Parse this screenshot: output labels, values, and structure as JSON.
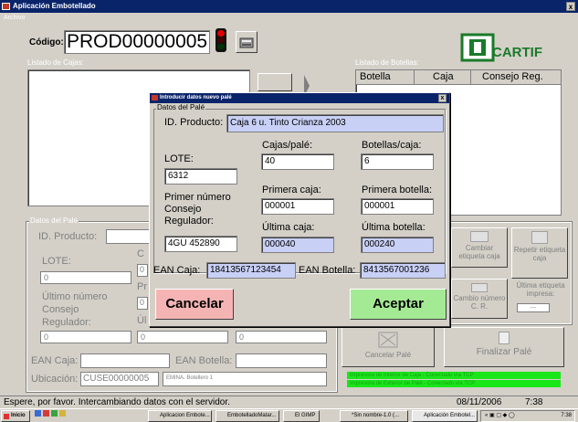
{
  "window": {
    "title": "Aplicación Embotellado",
    "menu": "Archivo"
  },
  "codigo": {
    "label": "Código:",
    "value": "PROD00000005"
  },
  "brand": {
    "logo_text": "CARTIF",
    "color": "#1a7a2a"
  },
  "listado_cajas": {
    "label": "Listado de Cajas:"
  },
  "listado_botellas": {
    "label": "Listado de Botellas:",
    "columns": [
      "Botella",
      "Caja",
      "Consejo Reg."
    ]
  },
  "datos_pale": {
    "group_label": "Datos del Palé",
    "id_producto_label": "ID. Producto:",
    "lote_label": "LOTE:",
    "lote_value": "0",
    "ultimo_numero_label": "Último número Consejo Regulador:",
    "ultimo_value": "0",
    "col2_values": [
      "0",
      "0",
      "0"
    ],
    "col3_value": "0",
    "ean_caja_label": "EAN Caja:",
    "ean_botella_label": "EAN Botella:",
    "ubicacion_label": "Ubicación:",
    "ubicacion_value": "CUSE00000005",
    "ubicacion_extra": "EMINA. Botellero 1"
  },
  "right_buttons": {
    "cambiar": "Cambiar etiqueta caja",
    "repetir": "Repetir etiqueta caja",
    "cambio_numero": "Cambio número C. R.",
    "ultima_label": "Última etiqueta impresa:",
    "ultima_value": "---",
    "cancelar_pale": "Cancelar Palé",
    "finalizar_pale": "Finalizar Palé"
  },
  "green_status": [
    "Impresora de Interior de Caja - Conectado vía TCP",
    "Impresora de Exterior de Palé - Conectado vía TCP"
  ],
  "dialog": {
    "title": "Introducir datos nuevo palé",
    "group": "Datos del Palé",
    "id_producto_label": "ID. Producto:",
    "id_producto_value": "Caja 6 u. Tinto Crianza 2003",
    "lote_label": "LOTE:",
    "lote_value": "6312",
    "primer_label": "Primer número Consejo Regulador:",
    "primer_value": "4GU 452890",
    "cajas_pale_label": "Cajas/palé:",
    "cajas_pale_value": "40",
    "primera_caja_label": "Primera caja:",
    "primera_caja_value": "000001",
    "ultima_caja_label": "Última caja:",
    "ultima_caja_value": "000040",
    "botellas_caja_label": "Botellas/caja:",
    "botellas_caja_value": "6",
    "primera_botella_label": "Primera botella:",
    "primera_botella_value": "000001",
    "ultima_botella_label": "Última botella:",
    "ultima_botella_value": "000240",
    "ean_caja_label": "EAN Caja:",
    "ean_caja_value": "18413567123454",
    "ean_botella_label": "EAN Botella:",
    "ean_botella_value": "8413567001236",
    "cancelar": "Cancelar",
    "aceptar": "Aceptar"
  },
  "status": {
    "message": "Espere, por favor. Intercambiando datos con el servidor.",
    "date": "08/11/2006",
    "time": "7:38"
  },
  "taskbar": {
    "start": "Inicio",
    "items": [
      "Aplicacion Embote...",
      "EmbotelladoMatar...",
      "El GIMP",
      "*Sin nombre-1.0 (...",
      "Aplicación Embotel..."
    ],
    "clock": "7:38"
  }
}
